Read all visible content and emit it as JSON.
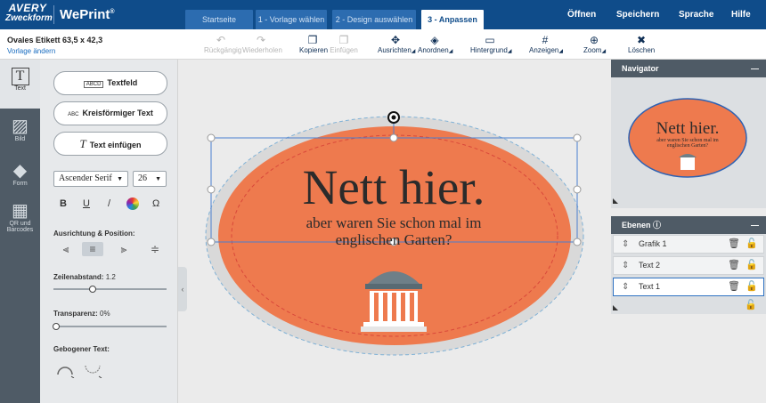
{
  "brand": {
    "avery_line1": "AVERY",
    "avery_line2": "Zweckform",
    "app": "WePrint",
    "app_mark": "®"
  },
  "steps": [
    {
      "label": "Startseite"
    },
    {
      "label": "1 - Vorlage wählen"
    },
    {
      "label": "2 - Design auswählen"
    },
    {
      "label": "3 - Anpassen"
    }
  ],
  "menu": {
    "open": "Öffnen",
    "save": "Speichern",
    "language": "Sprache",
    "help": "Hilfe"
  },
  "document": {
    "name": "Ovales Etikett 63,5 x 42,3",
    "change_template": "Vorlage ändern"
  },
  "toolbar": {
    "undo": "Rückgängig",
    "redo": "Wiederholen",
    "copy": "Kopieren",
    "paste": "Einfügen",
    "align": "Ausrichten",
    "arrange": "Anordnen",
    "background": "Hintergrund",
    "display": "Anzeigen",
    "zoom": "Zoom",
    "delete": "Löschen"
  },
  "rail": {
    "text": "Text",
    "image": "Bild",
    "shape": "Form",
    "qr1": "QR und",
    "qr2": "Barcodes"
  },
  "panel": {
    "textfield": "Textfeld",
    "textfield_icon": "ABCD",
    "circular": "Kreisförmiger Text",
    "circular_icon": "ABC",
    "insert_text": "Text einfügen",
    "font": "Ascender Serif",
    "size": "26",
    "bold": "B",
    "underline": "U",
    "italic": "/",
    "omega": "Ω",
    "alignment_label": "Ausrichtung & Position:",
    "line_spacing_label": "Zeilenabstand:",
    "line_spacing_value": "1.2",
    "transparency_label": "Transparenz:",
    "transparency_value": "0%",
    "curved_label": "Gebogener Text:",
    "line_spacing_fraction": 0.35,
    "transparency_fraction": 0.0
  },
  "label": {
    "headline": "Nett hier.",
    "subline1": "aber waren Sie schon mal im",
    "subline2": "englischen Garten?",
    "colors": {
      "orange": "#ee7a4e",
      "border": "#c9c9c9",
      "selection": "#4a7fd0"
    }
  },
  "navigator": {
    "title": "Navigator"
  },
  "layers": {
    "title": "Ebenen",
    "items": [
      {
        "label": "Grafik 1"
      },
      {
        "label": "Text 2"
      },
      {
        "label": "Text 1"
      }
    ]
  }
}
